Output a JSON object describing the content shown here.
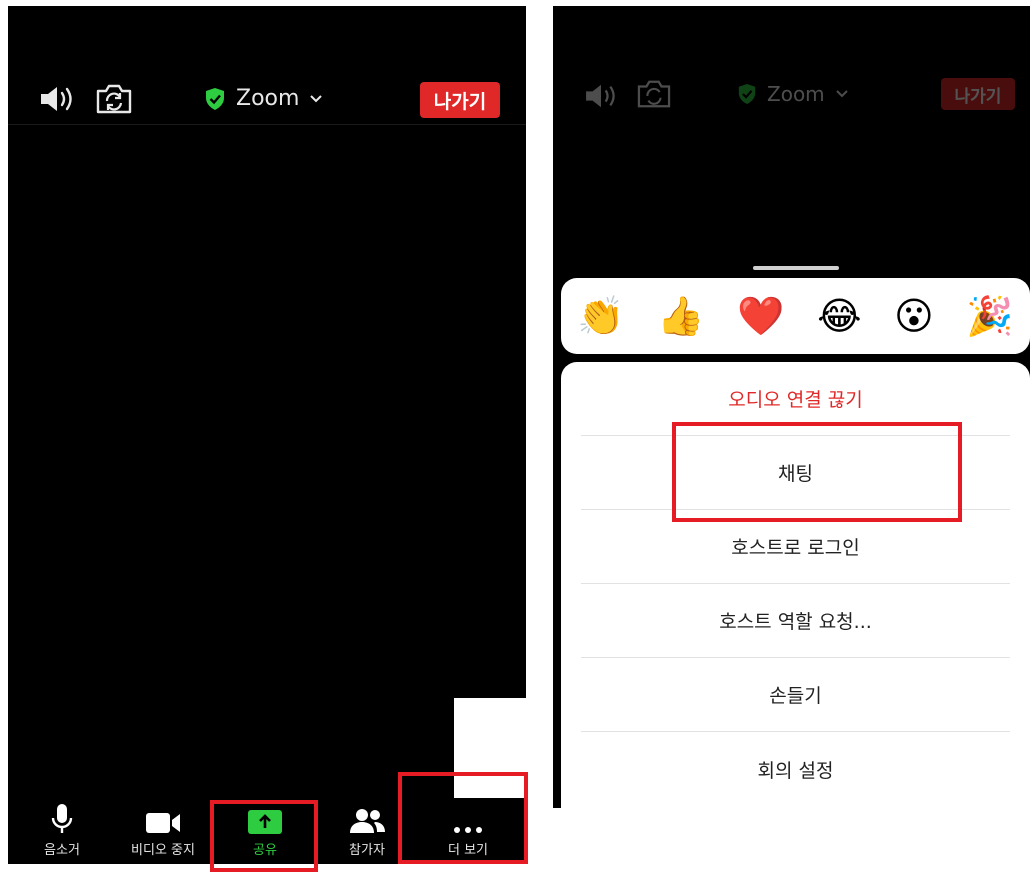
{
  "left_screen": {
    "header": {
      "title": "Zoom",
      "leave_label": "나가기",
      "speaker_icon": "speaker-icon",
      "camera_switch_icon": "camera-switch-icon",
      "shield_icon": "shield-check-icon",
      "chevron_icon": "chevron-down-icon"
    },
    "toolbar": [
      {
        "label": "음소거",
        "icon": "microphone-icon"
      },
      {
        "label": "비디오 중지",
        "icon": "video-camera-icon"
      },
      {
        "label": "공유",
        "icon": "share-arrow-icon"
      },
      {
        "label": "참가자",
        "icon": "participants-icon"
      },
      {
        "label": "더 보기",
        "icon": "more-dots-icon"
      }
    ]
  },
  "right_screen": {
    "header": {
      "title": "Zoom",
      "leave_label": "나가기"
    },
    "reactions": [
      "👏",
      "👍",
      "❤️",
      "😂",
      "😮",
      "🎉"
    ],
    "menu": [
      {
        "label": "오디오 연결 끊기",
        "style": "destructive"
      },
      {
        "label": "채팅"
      },
      {
        "label": "호스트로 로그인"
      },
      {
        "label": "호스트 역할 요청..."
      },
      {
        "label": "손들기"
      },
      {
        "label": "회의 설정"
      }
    ]
  },
  "colors": {
    "background": "#000000",
    "leave_red": "#e02828",
    "share_green": "#2ecc40",
    "highlight_red": "#e51c23",
    "sheet_white": "#ffffff"
  }
}
